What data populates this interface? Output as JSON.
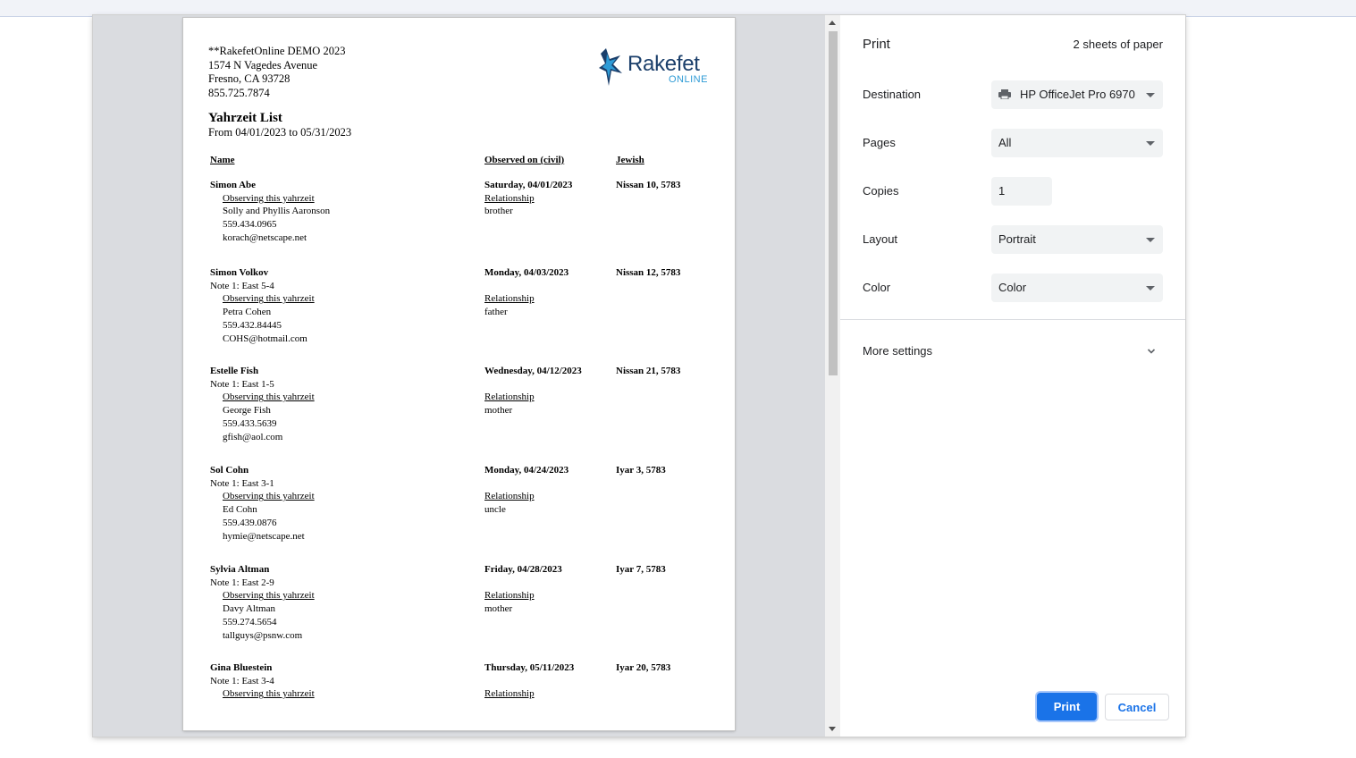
{
  "document": {
    "address_lines": [
      "**RakefetOnline DEMO 2023",
      "1574 N Vagedes Avenue",
      "Fresno, CA 93728",
      "855.725.7874"
    ],
    "logo": {
      "name": "Rakefet",
      "sub": "ONLINE"
    },
    "report_title": "Yahrzeit List",
    "date_range": "From 04/01/2023 to 05/31/2023",
    "headers": {
      "name": "Name",
      "observed": "Observed on (civil)",
      "jewish": "Jewish"
    },
    "observing_label": "Observing this yahrzeit",
    "relationship_label": "Relationship",
    "records": [
      {
        "name": "Simon Abe",
        "note": "",
        "observer": "Solly and Phyllis Aaronson",
        "phone": "559.434.0965",
        "email": "korach@netscape.net",
        "observed": "Saturday, 04/01/2023",
        "relationship": "brother",
        "jewish": "Nissan 10, 5783"
      },
      {
        "name": "Simon Volkov",
        "note": "Note 1: East 5-4",
        "observer": "Petra Cohen",
        "phone": "559.432.84445",
        "email": "COHS@hotmail.com",
        "observed": "Monday, 04/03/2023",
        "relationship": "father",
        "jewish": "Nissan 12, 5783"
      },
      {
        "name": "Estelle Fish",
        "note": "Note 1: East 1-5",
        "observer": "George Fish",
        "phone": "559.433.5639",
        "email": "gfish@aol.com",
        "observed": "Wednesday, 04/12/2023",
        "relationship": "mother",
        "jewish": "Nissan 21, 5783"
      },
      {
        "name": "Sol Cohn",
        "note": "Note 1: East 3-1",
        "observer": "Ed Cohn",
        "phone": "559.439.0876",
        "email": "hymie@netscape.net",
        "observed": "Monday, 04/24/2023",
        "relationship": "uncle",
        "jewish": "Iyar 3, 5783"
      },
      {
        "name": "Sylvia Altman",
        "note": "Note 1: East 2-9",
        "observer": "Davy Altman",
        "phone": "559.274.5654",
        "email": "tallguys@psnw.com",
        "observed": "Friday, 04/28/2023",
        "relationship": "mother",
        "jewish": "Iyar 7, 5783"
      },
      {
        "name": "Gina Bluestein",
        "note": "Note 1: East 3-4",
        "observer": "",
        "phone": "",
        "email": "",
        "observed": "Thursday, 05/11/2023",
        "relationship": "",
        "jewish": "Iyar 20, 5783"
      }
    ]
  },
  "settings": {
    "title": "Print",
    "sheets": "2 sheets of paper",
    "destination_label": "Destination",
    "destination_value": "HP OfficeJet Pro 6970",
    "pages_label": "Pages",
    "pages_value": "All",
    "copies_label": "Copies",
    "copies_value": "1",
    "layout_label": "Layout",
    "layout_value": "Portrait",
    "color_label": "Color",
    "color_value": "Color",
    "more_settings": "More settings",
    "print_button": "Print",
    "cancel_button": "Cancel"
  },
  "colors": {
    "accent": "#1a73e8",
    "preview_bg": "#dadce0",
    "logo_navy": "#1b3f6b",
    "logo_blue": "#2e9bd6"
  }
}
